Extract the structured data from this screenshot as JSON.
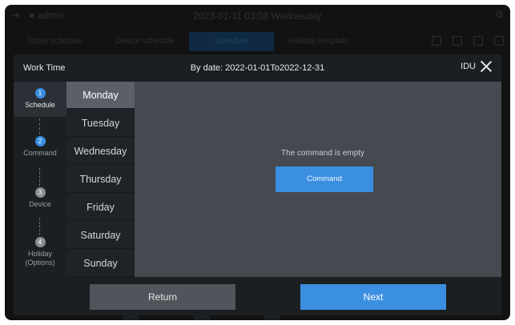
{
  "topbar": {
    "user": "admin",
    "datetime": "2023-01-11 03:08 Wednesday"
  },
  "bg_tabs": [
    "Today schedule",
    "Device schedule",
    "Schedule",
    "Holiday template"
  ],
  "modal": {
    "title": "Work Time",
    "date_range": "By date: 2022-01-01To2022-12-31",
    "idu_label": "IDU"
  },
  "steps": [
    {
      "num": "1",
      "label": "Schedule",
      "state": "done"
    },
    {
      "num": "2",
      "label": "Command",
      "state": "active"
    },
    {
      "num": "3",
      "label": "Device",
      "state": "pending"
    },
    {
      "num": "4",
      "label": "Holiday\n(Options)",
      "state": "pending"
    }
  ],
  "days": [
    "Monday",
    "Tuesday",
    "Wednesday",
    "Thursday",
    "Friday",
    "Saturday",
    "Sunday"
  ],
  "selected_day": "Monday",
  "content": {
    "empty_text": "The command is empty",
    "command_button": "Command"
  },
  "footer": {
    "return_label": "Return",
    "next_label": "Next"
  },
  "colors": {
    "accent": "#3b8fe0",
    "modal_bg": "#454a50",
    "panel_dark": "#1c1f22"
  }
}
